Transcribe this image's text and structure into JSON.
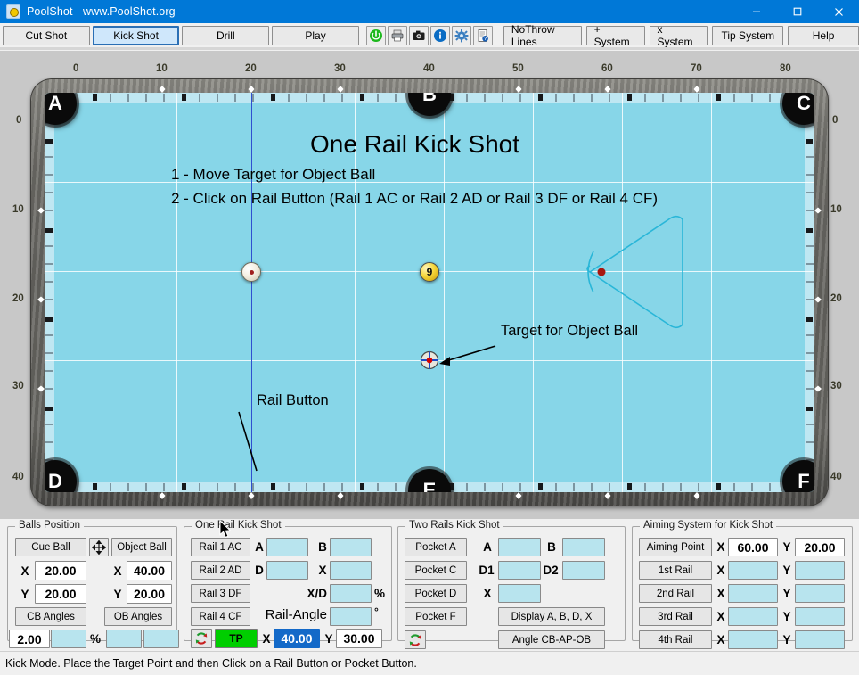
{
  "window": {
    "title": "PoolShot - www.PoolShot.org",
    "icon": "poolshot-app-icon",
    "minimize": "minimize",
    "maximize": "maximize",
    "close": "close"
  },
  "toolbar": {
    "tabs": [
      {
        "label": "Cut Shot",
        "selected": false
      },
      {
        "label": "Kick Shot",
        "selected": true
      },
      {
        "label": "Drill",
        "selected": false
      },
      {
        "label": "Play",
        "selected": false
      }
    ],
    "icons": [
      {
        "name": "power-icon",
        "glyph": "⏻",
        "color": "#17a317"
      },
      {
        "name": "printer-icon",
        "glyph": "⎙",
        "color": "#4a4a4a"
      },
      {
        "name": "camera-icon",
        "glyph": "■",
        "color": "#222222"
      },
      {
        "name": "info-icon",
        "glyph": "i",
        "color": "#0a6cc4"
      },
      {
        "name": "settings-gear-icon",
        "glyph": "⚙",
        "color": "#2f6fb5"
      },
      {
        "name": "help-document-icon",
        "glyph": "?",
        "color": "#444444"
      }
    ],
    "systems": [
      {
        "label": "NoThrow Lines"
      },
      {
        "label": "+ System"
      },
      {
        "label": "x System"
      },
      {
        "label": "Tip System"
      },
      {
        "label": "Help"
      }
    ]
  },
  "table": {
    "title": "One Rail Kick Shot",
    "step1": "1 - Move Target for Object Ball",
    "step2": "2 - Click on Rail Button (Rail 1 AC or Rail 2 AD or Rail 3 DF or Rail 4 CF)",
    "annotation_target": "Target for Object Ball",
    "annotation_rail_button": "Rail Button",
    "ruler_top": [
      "0",
      "10",
      "20",
      "30",
      "40",
      "50",
      "60",
      "70",
      "80"
    ],
    "ruler_left": [
      "0",
      "10",
      "20",
      "30",
      "40"
    ],
    "ruler_right": [
      "0",
      "10",
      "20",
      "30",
      "40"
    ],
    "pockets": [
      {
        "label": "A"
      },
      {
        "label": "B"
      },
      {
        "label": "C"
      },
      {
        "label": "D"
      },
      {
        "label": "E"
      },
      {
        "label": "F"
      }
    ],
    "cue_ball": {
      "name": "cue-ball",
      "x": "20.00",
      "y": "20.00"
    },
    "object_ball": {
      "name": "object-ball-9",
      "label": "9",
      "x": "40.00",
      "y": "20.00"
    },
    "target_point": {
      "name": "target-point",
      "x": "40.00",
      "y": "30.00"
    },
    "felt_color": "#87d6e8",
    "rail_color": "#6b6a65",
    "grid_color": "#ffffff",
    "aim_line_color": "#2f4fd0",
    "rack_outline_color": "#29b6d8"
  },
  "balls_position": {
    "group_title": "Balls Position",
    "cue_ball_button": "Cue Ball",
    "move_icon": "move-arrows-icon",
    "object_ball_button": "Object Ball",
    "cue_x_label": "X",
    "cue_x_value": "20.00",
    "cue_y_label": "Y",
    "cue_y_value": "20.00",
    "obj_x_label": "X",
    "obj_x_value": "40.00",
    "obj_y_label": "Y",
    "obj_y_value": "20.00",
    "cb_angles_button": "CB Angles",
    "ob_angles_button": "OB Angles",
    "cb_angle_value": "2.00",
    "cb_angle_secondary": "",
    "percent_label": "%",
    "ob_angle_1": "",
    "ob_angle_2": ""
  },
  "one_rail": {
    "group_title": "One Rail Kick Shot",
    "buttons": [
      "Rail 1 AC",
      "Rail 2 AD",
      "Rail 3 DF",
      "Rail 4 CF"
    ],
    "label_a": "A",
    "value_a": "",
    "label_b": "B",
    "value_b": "",
    "label_d": "D",
    "value_d": "",
    "label_x": "X",
    "value_x": "",
    "label_xd": "X/D",
    "value_xd": "",
    "percent": "%",
    "label_rail_angle": "Rail-Angle",
    "value_rail_angle": "",
    "degree": "°",
    "refresh_icon": "refresh-icon",
    "tp_button": "TP",
    "tp_x_label": "X",
    "tp_x_value": "40.00",
    "tp_y_label": "Y",
    "tp_y_value": "30.00"
  },
  "two_rails": {
    "group_title": "Two Rails Kick Shot",
    "buttons": [
      "Pocket A",
      "Pocket C",
      "Pocket D",
      "Pocket F"
    ],
    "label_a": "A",
    "value_a": "",
    "label_b": "B",
    "value_b": "",
    "label_d1": "D1",
    "value_d1": "",
    "label_d2": "D2",
    "value_d2": "",
    "label_x": "X",
    "value_x": "",
    "display_button": "Display A, B, D, X",
    "angle_button": "Angle CB-AP-OB",
    "refresh_icon": "refresh-icon"
  },
  "aiming_system": {
    "group_title": "Aiming System for Kick Shot",
    "rows": [
      {
        "button": "Aiming Point",
        "x_label": "X",
        "x_value": "60.00",
        "y_label": "Y",
        "y_value": "20.00",
        "filled": true
      },
      {
        "button": "1st Rail",
        "x_label": "X",
        "x_value": "",
        "y_label": "Y",
        "y_value": "",
        "filled": false
      },
      {
        "button": "2nd Rail",
        "x_label": "X",
        "x_value": "",
        "y_label": "Y",
        "y_value": "",
        "filled": false
      },
      {
        "button": "3rd Rail",
        "x_label": "X",
        "x_value": "",
        "y_label": "Y",
        "y_value": "",
        "filled": false
      },
      {
        "button": "4th Rail",
        "x_label": "X",
        "x_value": "",
        "y_label": "Y",
        "y_value": "",
        "filled": false
      }
    ]
  },
  "status": {
    "text": "Kick Mode. Place the Target Point and then Click on a Rail Button or Pocket Button."
  }
}
